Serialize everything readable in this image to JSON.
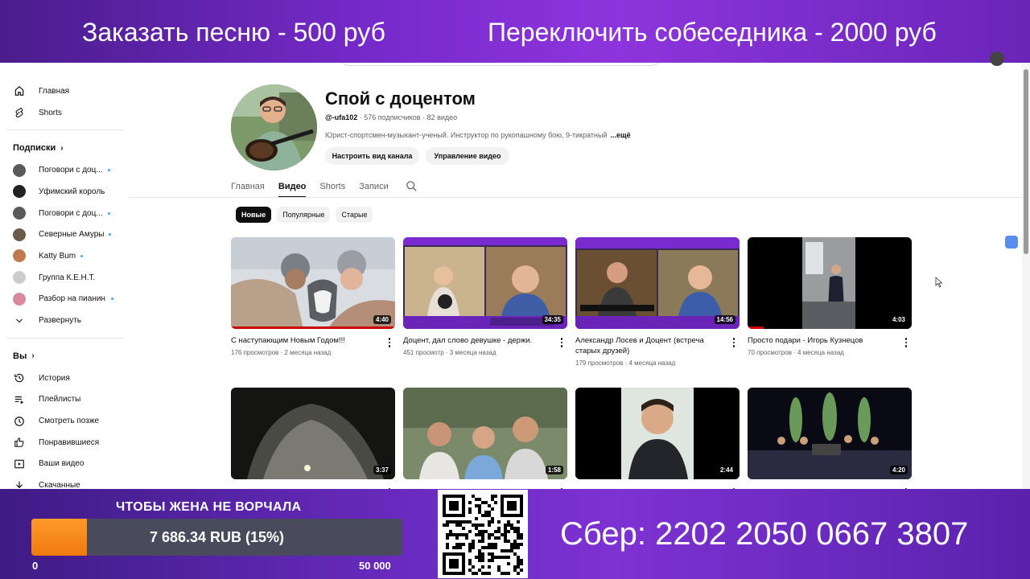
{
  "banner_top": {
    "left_text": "Заказать песню - 500 руб",
    "right_text": "Переключить собеседника - 2000 руб"
  },
  "sidebar": {
    "main_items": [
      {
        "label": "Главная",
        "icon": "home-icon"
      },
      {
        "label": "Shorts",
        "icon": "shorts-icon"
      }
    ],
    "subscriptions_header": "Подписки",
    "subscriptions": [
      {
        "label": "Поговори с доц...",
        "new": true,
        "color": "#5a5a5a"
      },
      {
        "label": "Уфимский король",
        "new": false,
        "color": "#222222"
      },
      {
        "label": "Поговори с доц...",
        "new": true,
        "color": "#5a5a5a"
      },
      {
        "label": "Северные Амуры",
        "new": true,
        "color": "#6b5a4a"
      },
      {
        "label": "Katty Bum",
        "new": true,
        "color": "#c07a50"
      },
      {
        "label": "Группа К.Е.Н.Т.",
        "new": false,
        "color": "#cccccc"
      },
      {
        "label": "Разбор на пианин...",
        "new": true,
        "color": "#d98a9a"
      }
    ],
    "expand_label": "Развернуть",
    "you_header": "Вы",
    "you_items": [
      {
        "label": "История",
        "icon": "history-icon"
      },
      {
        "label": "Плейлисты",
        "icon": "playlists-icon"
      },
      {
        "label": "Смотреть позже",
        "icon": "watch-later-icon"
      },
      {
        "label": "Понравившиеся",
        "icon": "like-icon"
      },
      {
        "label": "Ваши видео",
        "icon": "your-videos-icon"
      },
      {
        "label": "Скачанные",
        "icon": "downloads-icon"
      }
    ]
  },
  "channel": {
    "name": "Спой с доцентом",
    "handle": "@-ufa102",
    "stats": " · 576 подписчиков · 82 видео",
    "description": "Юрист-спортсмен-музыкант-ученый. Инструктор по рукопашному бою, 9-тикратный",
    "more": "...ещё",
    "customize_button": "Настроить вид канала",
    "manage_button": "Управление видео"
  },
  "tabs": [
    {
      "label": "Главная",
      "active": false
    },
    {
      "label": "Видео",
      "active": true
    },
    {
      "label": "Shorts",
      "active": false
    },
    {
      "label": "Записи",
      "active": false
    }
  ],
  "chips": [
    {
      "label": "Новые",
      "active": true
    },
    {
      "label": "Популярные",
      "active": false
    },
    {
      "label": "Старые",
      "active": false
    }
  ],
  "videos": [
    {
      "title": "С наступающим Новым Годом!!!",
      "meta": "176 просмотров · 2 месяца назад",
      "duration": "4:40"
    },
    {
      "title": "Доцент, дал слово девушке - держи.",
      "meta": "451 просмотр · 3 месяца назад",
      "duration": "34:35"
    },
    {
      "title": "Александр Лосев и Доцент (встреча старых друзей)",
      "meta": "179 просмотров · 4 месяца назад",
      "duration": "14:56"
    },
    {
      "title": "Просто подари - Игорь Кузнецов",
      "meta": "70 просмотров · 4 месяца назад",
      "duration": "4:03"
    },
    {
      "title": "",
      "meta": "",
      "duration": "3:37"
    },
    {
      "title": "",
      "meta": "",
      "duration": "1:58"
    },
    {
      "title": "",
      "meta": "",
      "duration": "2:44"
    },
    {
      "title": "",
      "meta": "",
      "duration": "4:20"
    }
  ],
  "banner_bottom": {
    "goal_title": "ЧТОБЫ ЖЕНА НЕ ВОРЧАЛА",
    "goal_text": "7 686.34 RUB (15%)",
    "goal_progress": 0.15,
    "goal_min": "0",
    "goal_max": "50 000",
    "sber_text": "Сбер: 2202 2050 0667 3807"
  },
  "colors": {
    "accent_purple": "#7b2bd0",
    "progress_orange": "#f07a0c",
    "subscription_dot": "#3ea6ff",
    "watched_red": "#cc0000"
  }
}
